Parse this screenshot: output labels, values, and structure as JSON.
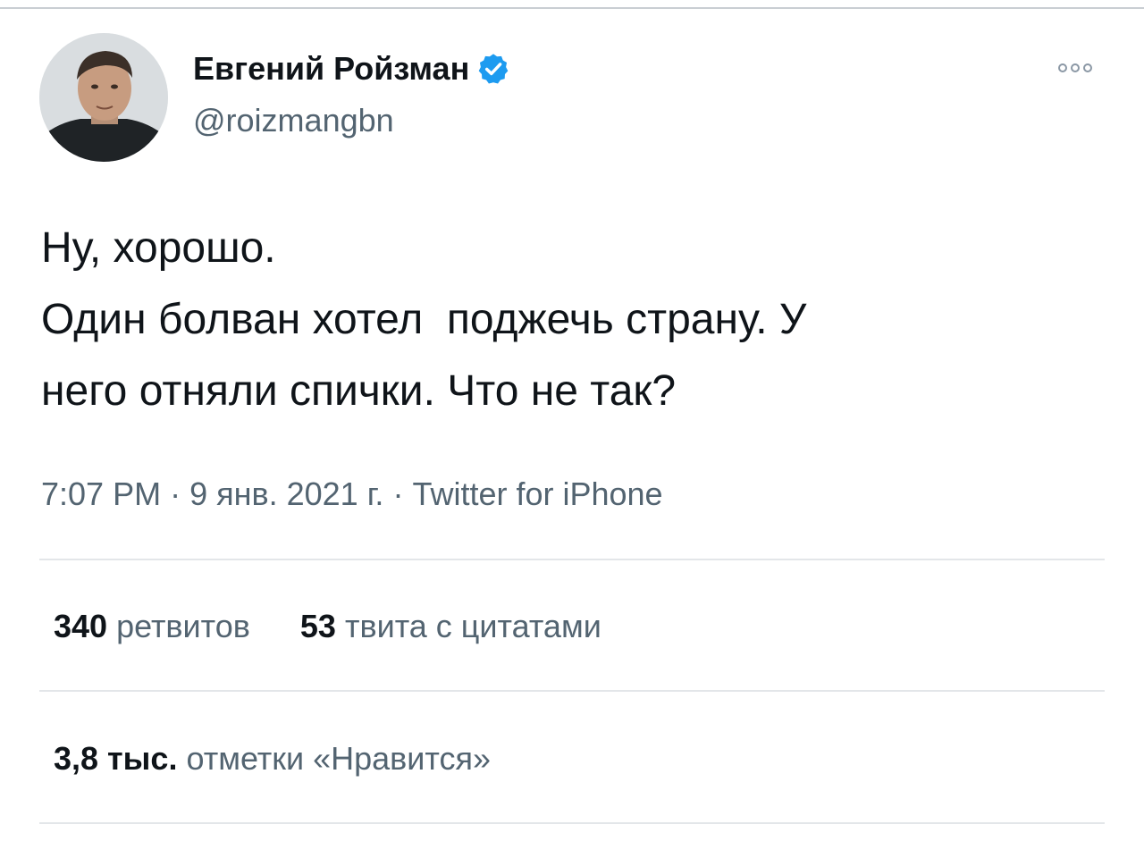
{
  "author": {
    "display_name": "Евгений Ройзман",
    "handle": "@roizmangbn",
    "verified": true
  },
  "tweet": {
    "text": "Ну, хорошо.\nОдин болван хотел  поджечь страну. У\nнего отняли спички. Что не так?",
    "time": "7:07 PM",
    "date": "9 янв. 2021 г.",
    "source": "Twitter for iPhone"
  },
  "stats": {
    "retweets_count": "340",
    "retweets_label": "ретвитов",
    "quotes_count": "53",
    "quotes_label": "твита с цитатами",
    "likes_count": "3,8 тыс.",
    "likes_label": "отметки «Нравится»"
  },
  "icons": {
    "verified": "verified-badge-icon",
    "more": "more-options-icon"
  },
  "colors": {
    "verified_blue": "#1d9bf0",
    "secondary_text": "#536471",
    "primary_text": "#0f1419",
    "divider": "#e3e6e9"
  }
}
